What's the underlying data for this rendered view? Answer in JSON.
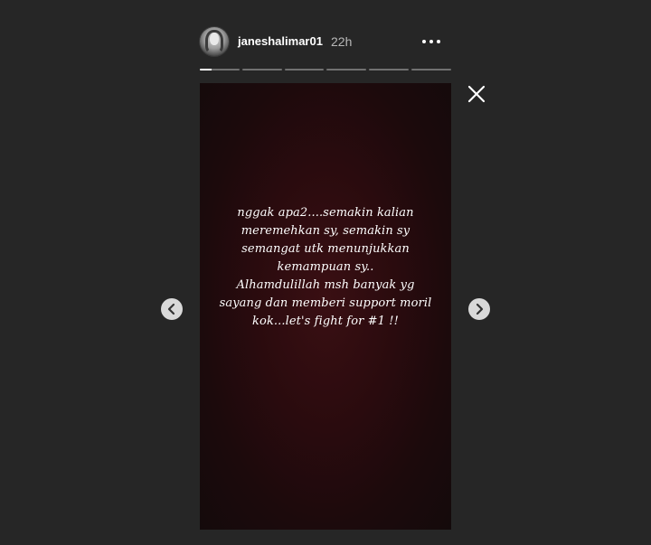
{
  "header": {
    "username": "janeshalimar01",
    "timestamp": "22h",
    "avatar_icon": "user-avatar",
    "more_icon": "more-horizontal-icon"
  },
  "progress": {
    "segment_count": 6,
    "active_index": 0,
    "active_fraction": 0.3
  },
  "story": {
    "background_color": "#2a0b0e",
    "lines": [
      "nggak apa2....semakin kalian",
      "meremehkan sy, semakin sy",
      "semangat utk  menunjukkan",
      "kemampuan sy..",
      "Alhamdulillah msh banyak yg",
      "sayang dan memberi support moril",
      "kok...let's fight for #1 !!"
    ]
  },
  "controls": {
    "close_icon": "close-icon",
    "prev_icon": "chevron-left-icon",
    "next_icon": "chevron-right-icon"
  },
  "colors": {
    "page_background": "#262626",
    "text_primary": "#ffffff",
    "text_secondary": "#b8b8b8",
    "nav_button": "#d9d9d9"
  }
}
